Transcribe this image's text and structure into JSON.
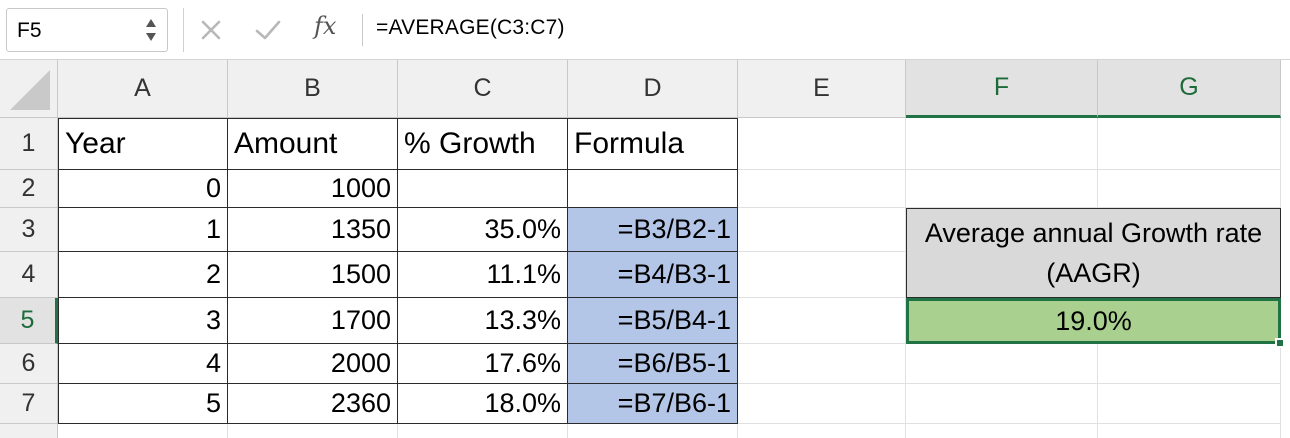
{
  "formula_bar": {
    "name_box": "F5",
    "cancel_icon": "x-icon",
    "enter_icon": "check-icon",
    "fx_label": "fx",
    "formula": "=AVERAGE(C3:C7)"
  },
  "columns": [
    "A",
    "B",
    "C",
    "D",
    "E",
    "F",
    "G"
  ],
  "rows": [
    "1",
    "2",
    "3",
    "4",
    "5",
    "6",
    "7"
  ],
  "selected": {
    "column": "F",
    "row": "5"
  },
  "table": {
    "headers": [
      "Year",
      "Amount",
      "% Growth",
      "Formula"
    ],
    "rows": [
      {
        "year": "0",
        "amount": "1000",
        "growth": "",
        "formula": ""
      },
      {
        "year": "1",
        "amount": "1350",
        "growth": "35.0%",
        "formula": "=B3/B2-1"
      },
      {
        "year": "2",
        "amount": "1500",
        "growth": "11.1%",
        "formula": "=B4/B3-1"
      },
      {
        "year": "3",
        "amount": "1700",
        "growth": "13.3%",
        "formula": "=B5/B4-1"
      },
      {
        "year": "4",
        "amount": "2000",
        "growth": "17.6%",
        "formula": "=B6/B5-1"
      },
      {
        "year": "5",
        "amount": "2360",
        "growth": "18.0%",
        "formula": "=B7/B6-1"
      }
    ]
  },
  "aagr": {
    "label": "Average annual Growth rate (AAGR)",
    "value": "19.0%"
  },
  "colors": {
    "selection_green": "#217346",
    "formula_cell_blue": "#b4c6e7",
    "label_gray": "#d9d9d9",
    "value_green": "#a9d08e"
  }
}
